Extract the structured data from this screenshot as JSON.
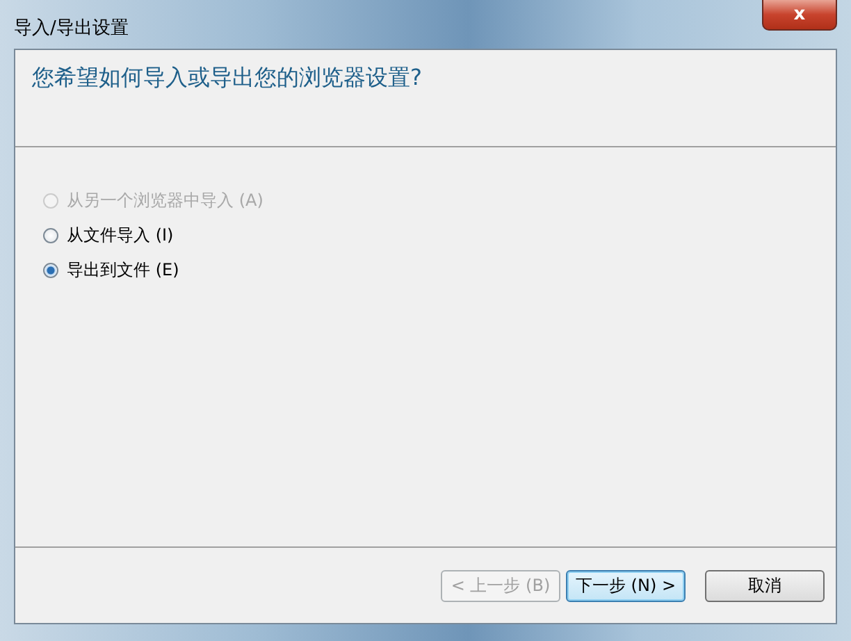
{
  "window": {
    "title": "导入/导出设置",
    "close": "x"
  },
  "header": {
    "question": "您希望如何导入或导出您的浏览器设置?"
  },
  "options": [
    {
      "label": "从另一个浏览器中导入 (A)",
      "disabled": true,
      "selected": false
    },
    {
      "label": "从文件导入 (I)",
      "disabled": false,
      "selected": false
    },
    {
      "label": "导出到文件 (E)",
      "disabled": false,
      "selected": true
    }
  ],
  "buttons": [
    {
      "label": "< 上一步 (B)",
      "disabled": true,
      "focused": false
    },
    {
      "label": "下一步 (N) >",
      "disabled": false,
      "focused": true
    },
    {
      "label": "取消",
      "disabled": false,
      "focused": false
    }
  ]
}
